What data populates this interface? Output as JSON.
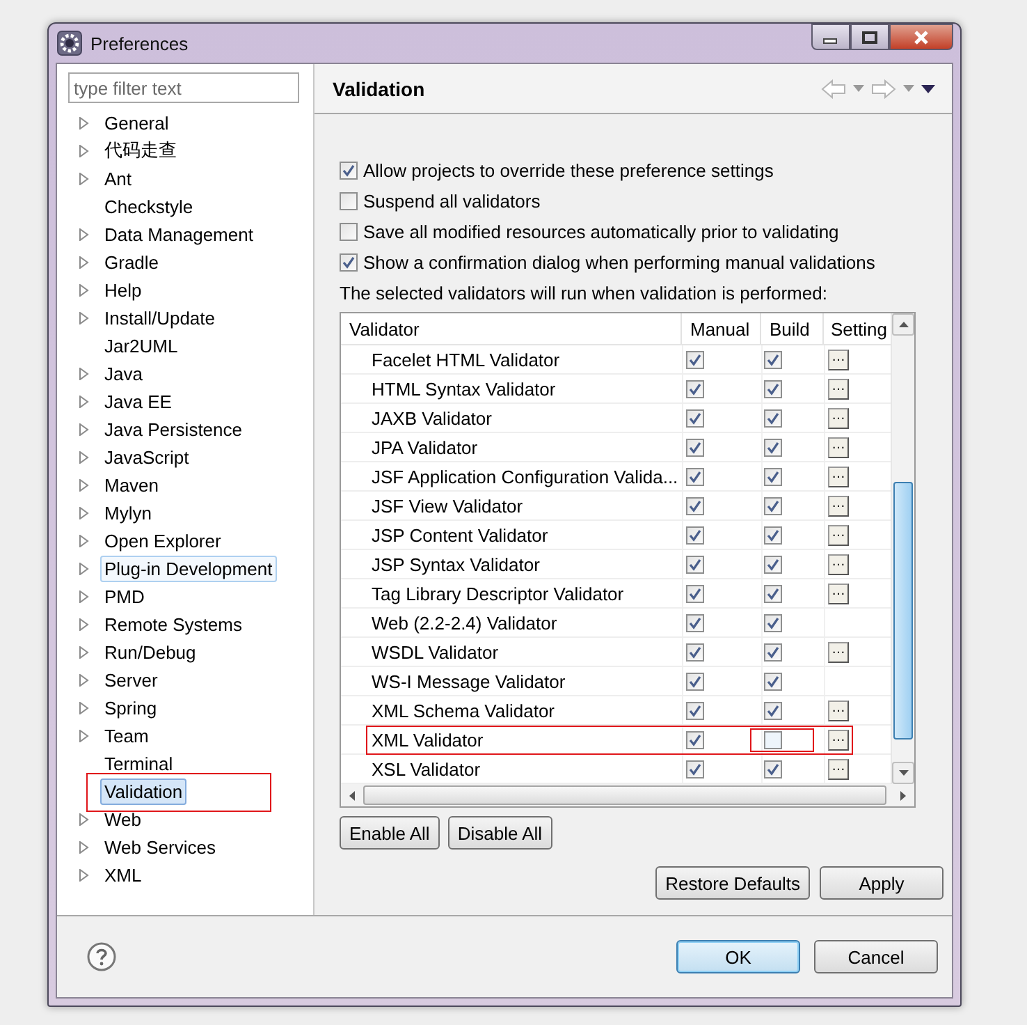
{
  "window": {
    "title": "Preferences"
  },
  "filter": {
    "placeholder": "type filter text"
  },
  "tree": [
    {
      "label": "General",
      "expandable": true,
      "selected": false,
      "focused": false,
      "annotated": false
    },
    {
      "label": "代码走查",
      "expandable": true,
      "selected": false,
      "focused": false,
      "annotated": false
    },
    {
      "label": "Ant",
      "expandable": true,
      "selected": false,
      "focused": false,
      "annotated": false
    },
    {
      "label": "Checkstyle",
      "expandable": false,
      "selected": false,
      "focused": false,
      "annotated": false
    },
    {
      "label": "Data Management",
      "expandable": true,
      "selected": false,
      "focused": false,
      "annotated": false
    },
    {
      "label": "Gradle",
      "expandable": true,
      "selected": false,
      "focused": false,
      "annotated": false
    },
    {
      "label": "Help",
      "expandable": true,
      "selected": false,
      "focused": false,
      "annotated": false
    },
    {
      "label": "Install/Update",
      "expandable": true,
      "selected": false,
      "focused": false,
      "annotated": false
    },
    {
      "label": "Jar2UML",
      "expandable": false,
      "selected": false,
      "focused": false,
      "annotated": false
    },
    {
      "label": "Java",
      "expandable": true,
      "selected": false,
      "focused": false,
      "annotated": false
    },
    {
      "label": "Java EE",
      "expandable": true,
      "selected": false,
      "focused": false,
      "annotated": false
    },
    {
      "label": "Java Persistence",
      "expandable": true,
      "selected": false,
      "focused": false,
      "annotated": false
    },
    {
      "label": "JavaScript",
      "expandable": true,
      "selected": false,
      "focused": false,
      "annotated": false
    },
    {
      "label": "Maven",
      "expandable": true,
      "selected": false,
      "focused": false,
      "annotated": false
    },
    {
      "label": "Mylyn",
      "expandable": true,
      "selected": false,
      "focused": false,
      "annotated": false
    },
    {
      "label": "Open Explorer",
      "expandable": true,
      "selected": false,
      "focused": false,
      "annotated": false
    },
    {
      "label": "Plug-in Development",
      "expandable": true,
      "selected": false,
      "focused": true,
      "annotated": false
    },
    {
      "label": "PMD",
      "expandable": true,
      "selected": false,
      "focused": false,
      "annotated": false
    },
    {
      "label": "Remote Systems",
      "expandable": true,
      "selected": false,
      "focused": false,
      "annotated": false
    },
    {
      "label": "Run/Debug",
      "expandable": true,
      "selected": false,
      "focused": false,
      "annotated": false
    },
    {
      "label": "Server",
      "expandable": true,
      "selected": false,
      "focused": false,
      "annotated": false
    },
    {
      "label": "Spring",
      "expandable": true,
      "selected": false,
      "focused": false,
      "annotated": false
    },
    {
      "label": "Team",
      "expandable": true,
      "selected": false,
      "focused": false,
      "annotated": false
    },
    {
      "label": "Terminal",
      "expandable": false,
      "selected": false,
      "focused": false,
      "annotated": false
    },
    {
      "label": "Validation",
      "expandable": false,
      "selected": true,
      "focused": false,
      "annotated": true
    },
    {
      "label": "Web",
      "expandable": true,
      "selected": false,
      "focused": false,
      "annotated": false
    },
    {
      "label": "Web Services",
      "expandable": true,
      "selected": false,
      "focused": false,
      "annotated": false
    },
    {
      "label": "XML",
      "expandable": true,
      "selected": false,
      "focused": false,
      "annotated": false
    }
  ],
  "page": {
    "title": "Validation"
  },
  "options": [
    {
      "label": "Allow projects to override these preference settings",
      "checked": true
    },
    {
      "label": "Suspend all validators",
      "checked": false
    },
    {
      "label": "Save all modified resources automatically prior to validating",
      "checked": false
    },
    {
      "label": "Show a confirmation dialog when performing manual validations",
      "checked": true
    }
  ],
  "table_caption": "The selected validators will run when validation is performed:",
  "table": {
    "columns": [
      "Validator",
      "Manual",
      "Build",
      "Setting"
    ],
    "rows": [
      {
        "name": "Facelet HTML Validator",
        "manual": true,
        "build": true,
        "settings": "…",
        "annotated": false,
        "build_annotated": false
      },
      {
        "name": "HTML Syntax Validator",
        "manual": true,
        "build": true,
        "settings": "…",
        "annotated": false,
        "build_annotated": false
      },
      {
        "name": "JAXB Validator",
        "manual": true,
        "build": true,
        "settings": "…",
        "annotated": false,
        "build_annotated": false
      },
      {
        "name": "JPA Validator",
        "manual": true,
        "build": true,
        "settings": "…",
        "annotated": false,
        "build_annotated": false
      },
      {
        "name": "JSF Application Configuration Valida...",
        "manual": true,
        "build": true,
        "settings": "…",
        "annotated": false,
        "build_annotated": false
      },
      {
        "name": "JSF View Validator",
        "manual": true,
        "build": true,
        "settings": "…",
        "annotated": false,
        "build_annotated": false
      },
      {
        "name": "JSP Content Validator",
        "manual": true,
        "build": true,
        "settings": "…",
        "annotated": false,
        "build_annotated": false
      },
      {
        "name": "JSP Syntax Validator",
        "manual": true,
        "build": true,
        "settings": "…",
        "annotated": false,
        "build_annotated": false
      },
      {
        "name": "Tag Library Descriptor Validator",
        "manual": true,
        "build": true,
        "settings": "…",
        "annotated": false,
        "build_annotated": false
      },
      {
        "name": "Web (2.2-2.4) Validator",
        "manual": true,
        "build": true,
        "annotated": false,
        "build_annotated": false
      },
      {
        "name": "WSDL Validator",
        "manual": true,
        "build": true,
        "settings": "…",
        "annotated": false,
        "build_annotated": false
      },
      {
        "name": "WS-I Message Validator",
        "manual": true,
        "build": true,
        "annotated": false,
        "build_annotated": false
      },
      {
        "name": "XML Schema Validator",
        "manual": true,
        "build": true,
        "settings": "…",
        "annotated": false,
        "build_annotated": false
      },
      {
        "name": "XML Validator",
        "manual": true,
        "build": false,
        "settings": "…",
        "annotated": true,
        "build_annotated": true
      },
      {
        "name": "XSL Validator",
        "manual": true,
        "build": true,
        "settings": "…",
        "annotated": false,
        "build_annotated": false
      }
    ]
  },
  "table_buttons": [
    "Enable All",
    "Disable All"
  ],
  "page_buttons": [
    "Restore Defaults",
    "Apply"
  ],
  "dialog_buttons": [
    {
      "label": "OK",
      "default": true
    },
    {
      "label": "Cancel",
      "default": false
    }
  ]
}
